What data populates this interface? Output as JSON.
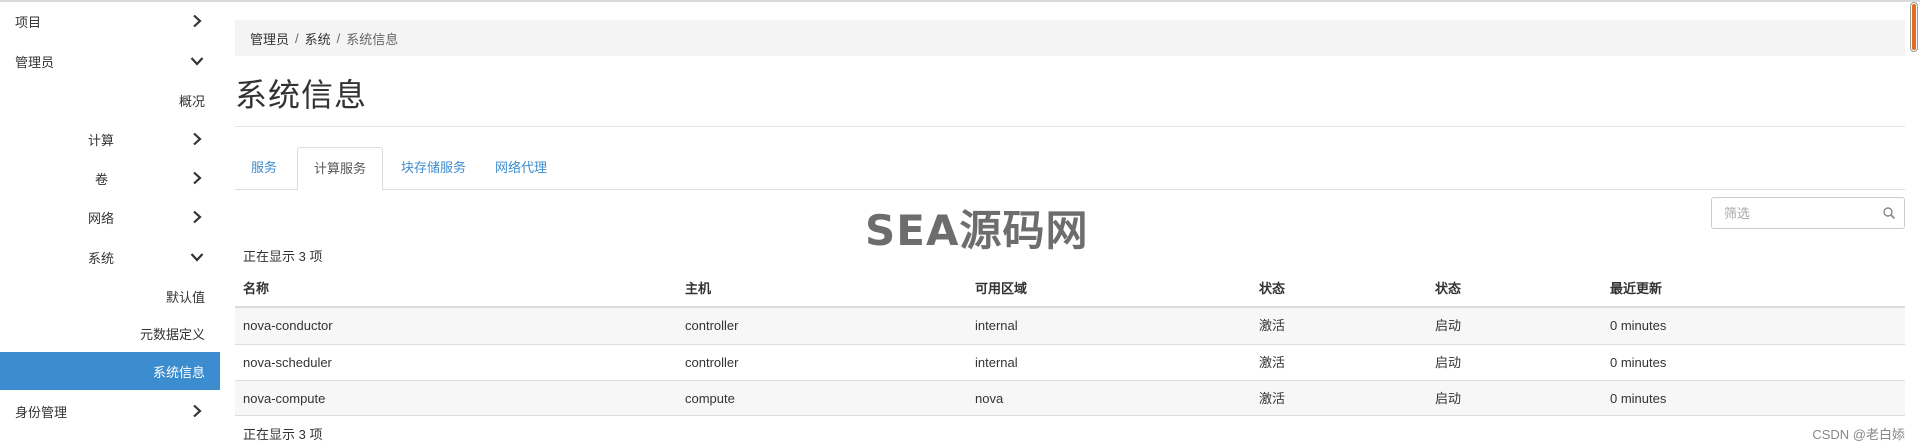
{
  "sidebar": {
    "items": [
      {
        "label": "项目",
        "chevron": "right"
      },
      {
        "label": "管理员",
        "chevron": "down"
      },
      {
        "label": "概况",
        "chevron": ""
      },
      {
        "label": "计算",
        "chevron": "right"
      },
      {
        "label": "卷",
        "chevron": "right"
      },
      {
        "label": "网络",
        "chevron": "right"
      },
      {
        "label": "系统",
        "chevron": "down"
      },
      {
        "label": "默认值",
        "chevron": ""
      },
      {
        "label": "元数据定义",
        "chevron": ""
      },
      {
        "label": "系统信息",
        "chevron": "",
        "active": true
      },
      {
        "label": "身份管理",
        "chevron": "right"
      }
    ]
  },
  "breadcrumb": [
    "管理员",
    "系统",
    "系统信息"
  ],
  "page_title": "系统信息",
  "tabs": [
    {
      "label": "服务",
      "active": false
    },
    {
      "label": "计算服务",
      "active": true
    },
    {
      "label": "块存储服务",
      "active": false
    },
    {
      "label": "网络代理",
      "active": false
    }
  ],
  "filter": {
    "placeholder": "筛选",
    "value": ""
  },
  "watermark": "SEA源码网",
  "count_text": "正在显示 3 项",
  "table": {
    "headers": [
      "名称",
      "主机",
      "可用区域",
      "状态",
      "状态",
      "最近更新"
    ],
    "rows": [
      [
        "nova-conductor",
        "controller",
        "internal",
        "激活",
        "启动",
        "0 minutes"
      ],
      [
        "nova-scheduler",
        "controller",
        "internal",
        "激活",
        "启动",
        "0 minutes"
      ],
      [
        "nova-compute",
        "compute",
        "nova",
        "激活",
        "启动",
        "0 minutes"
      ]
    ]
  },
  "credit": "CSDN @老白婖",
  "colors": {
    "accent": "#3c8dd0",
    "scroll_thumb": "#e0701f"
  }
}
